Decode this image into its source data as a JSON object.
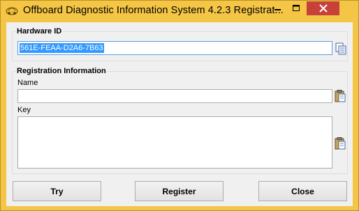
{
  "window": {
    "title": "Offboard Diagnostic Information System 4.2.3 Registrat...",
    "close_glyph": "✕"
  },
  "hardware": {
    "group_title": "Hardware ID",
    "value": "561E-FEAA-D2A6-7B63"
  },
  "registration": {
    "group_title": "Registration Information",
    "name_label": "Name",
    "name_value": "",
    "key_label": "Key",
    "key_value": ""
  },
  "buttons": {
    "try": "Try",
    "register": "Register",
    "close": "Close"
  },
  "icons": {
    "app": "car-icon",
    "copy": "copy-icon",
    "paste": "paste-icon"
  },
  "colors": {
    "window_frame": "#f5c646",
    "close_button": "#c7403a",
    "selection": "#3399ff"
  }
}
